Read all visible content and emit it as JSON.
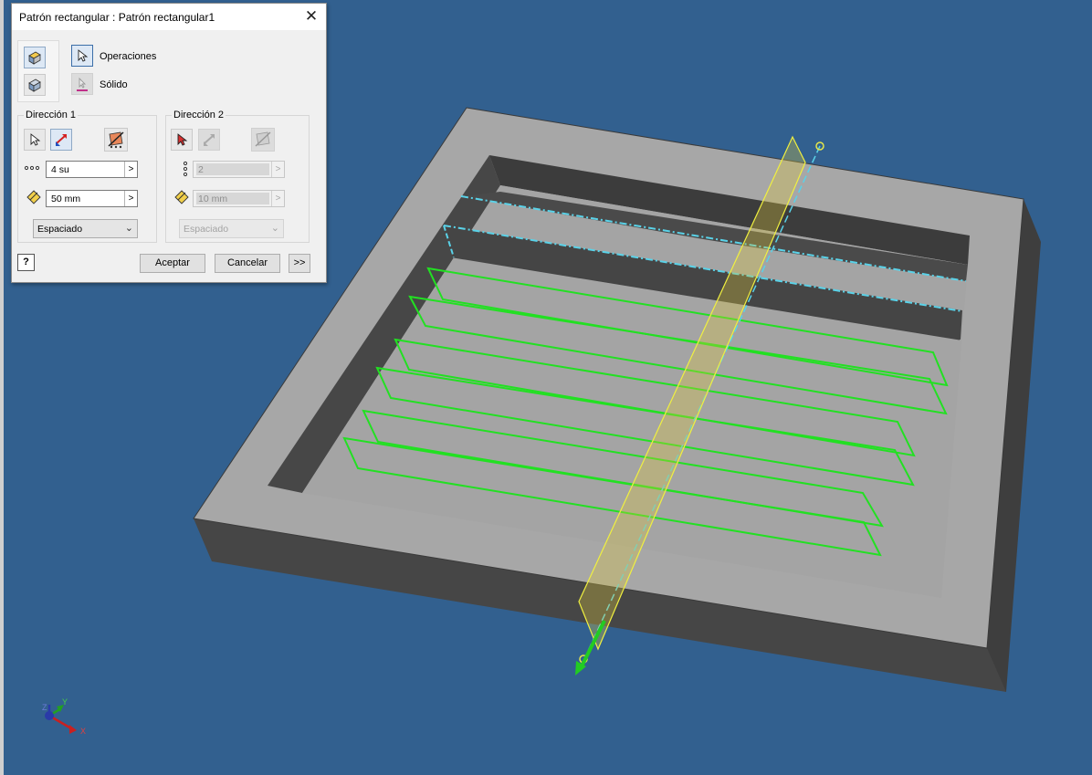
{
  "dialog": {
    "title": "Patrón rectangular : Patrón rectangular1",
    "close_glyph": "✕",
    "selection": {
      "features_label": "Operaciones",
      "solid_label": "Sólido"
    },
    "direction1": {
      "title": "Dirección 1",
      "count": "4 su",
      "spacing": "50 mm",
      "method": "Espaciado"
    },
    "direction2": {
      "title": "Dirección 2",
      "count": "2",
      "spacing": "10 mm",
      "method": "Espaciado"
    },
    "help_glyph": "?",
    "ok_label": "Aceptar",
    "cancel_label": "Cancelar",
    "more_label": ">>"
  },
  "triad": {
    "x_label": "X",
    "y_label": "Y",
    "z_label": "Z"
  },
  "colors": {
    "background": "#32608f",
    "part_top": "#a6a6a6",
    "part_side": "#4a4a4a",
    "preview": "#22e022",
    "axis": "#5ad2e8",
    "direction_arrow": "#f0f040"
  },
  "icons": {
    "pattern_features": "pattern-features-icon",
    "pattern_solid": "pattern-solid-icon",
    "select": "select-cursor-icon",
    "flip": "flip-direction-icon",
    "midplane": "midplane-icon",
    "count": "count-dots-icon",
    "spacing": "spacing-diamond-icon",
    "help": "help-icon"
  }
}
